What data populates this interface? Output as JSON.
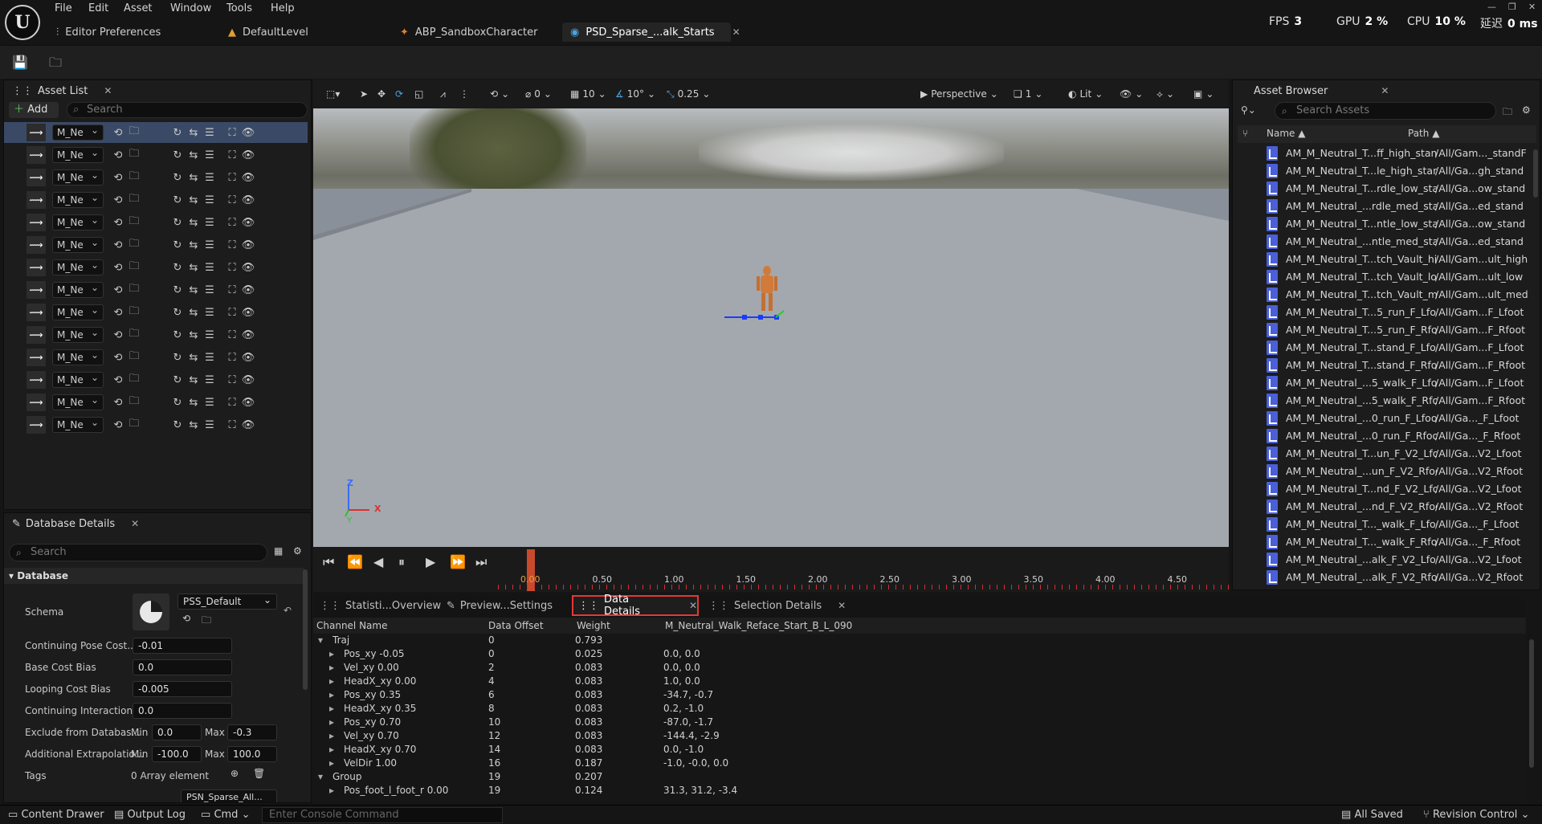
{
  "menubar": {
    "items": [
      "File",
      "Edit",
      "Asset",
      "Window",
      "Tools",
      "Help"
    ]
  },
  "doc_tabs": [
    {
      "label": "Editor Preferences"
    },
    {
      "label": "DefaultLevel"
    },
    {
      "label": "ABP_SandboxCharacter"
    },
    {
      "label": "PSD_Sparse_...alk_Starts"
    }
  ],
  "stats": {
    "fps_label": "FPS",
    "fps": "3",
    "gpu_label": "GPU",
    "gpu": "2 %",
    "cpu_label": "CPU",
    "cpu": "10 %",
    "latency_label": "延迟",
    "latency": "0 ms"
  },
  "asset_list": {
    "title": "Asset List",
    "add_label": "Add",
    "search_placeholder": "Search",
    "row_label": "M_Ne",
    "row_count": 14
  },
  "viewport": {
    "snap_rotate": "0",
    "snap_grid": "10",
    "snap_angle": "10°",
    "snap_scale": "0.25",
    "view_mode": "Perspective",
    "view_count": "1",
    "lit_label": "Lit",
    "axis_x": "X",
    "axis_z": "Z",
    "axis_y": "Y"
  },
  "timeline": {
    "ticks": [
      "0.00",
      "0.50",
      "1.00",
      "1.50",
      "2.00",
      "2.50",
      "3.00",
      "3.50",
      "4.00",
      "4.50"
    ]
  },
  "bottom_tabs": [
    {
      "label": "Statisti...Overview"
    },
    {
      "label": "Preview...Settings"
    },
    {
      "label": "Data Details"
    },
    {
      "label": "Selection Details"
    }
  ],
  "data_details": {
    "columns": [
      "Channel Name",
      "Data Offset",
      "Weight",
      "M_Neutral_Walk_Reface_Start_B_L_090"
    ],
    "rows": [
      {
        "name": "Traj",
        "offset": "0",
        "weight": "0.793",
        "value": "",
        "group": true
      },
      {
        "name": "Pos_xy -0.05",
        "offset": "0",
        "weight": "0.025",
        "value": "0.0, 0.0"
      },
      {
        "name": "Vel_xy 0.00",
        "offset": "2",
        "weight": "0.083",
        "value": "0.0, 0.0"
      },
      {
        "name": "HeadX_xy 0.00",
        "offset": "4",
        "weight": "0.083",
        "value": "1.0, 0.0"
      },
      {
        "name": "Pos_xy 0.35",
        "offset": "6",
        "weight": "0.083",
        "value": "-34.7, -0.7"
      },
      {
        "name": "HeadX_xy 0.35",
        "offset": "8",
        "weight": "0.083",
        "value": "0.2, -1.0"
      },
      {
        "name": "Pos_xy 0.70",
        "offset": "10",
        "weight": "0.083",
        "value": "-87.0, -1.7"
      },
      {
        "name": "Vel_xy 0.70",
        "offset": "12",
        "weight": "0.083",
        "value": "-144.4, -2.9"
      },
      {
        "name": "HeadX_xy 0.70",
        "offset": "14",
        "weight": "0.083",
        "value": "0.0, -1.0"
      },
      {
        "name": "VelDir 1.00",
        "offset": "16",
        "weight": "0.187",
        "value": "-1.0, -0.0, 0.0"
      },
      {
        "name": "Group",
        "offset": "19",
        "weight": "0.207",
        "value": "",
        "group": true
      },
      {
        "name": "Pos_foot_l_foot_r 0.00",
        "offset": "19",
        "weight": "0.124",
        "value": "31.3, 31.2, -3.4"
      }
    ]
  },
  "database_details": {
    "title": "Database Details",
    "search_placeholder": "Search",
    "section": "Database",
    "schema_label": "Schema",
    "schema_value": "PSS_Default",
    "continuing_pose_label": "Continuing Pose Cost...",
    "continuing_pose_value": "-0.01",
    "base_cost_label": "Base Cost Bias",
    "base_cost_value": "0.0",
    "looping_cost_label": "Looping Cost Bias",
    "looping_cost_value": "-0.005",
    "continuing_interaction_label": "Continuing Interaction...",
    "continuing_interaction_value": "0.0",
    "exclude_label": "Exclude from Databas...",
    "min_label": "Min",
    "max_label": "Max",
    "exclude_min": "0.0",
    "exclude_max": "-0.3",
    "extrapolation_label": "Additional Extrapolatio...",
    "extrap_min": "-100.0",
    "extrap_max": "100.0",
    "tags_label": "Tags",
    "tags_value": "0 Array element",
    "next_dropdown": "PSN_Sparse_All..."
  },
  "asset_browser": {
    "title": "Asset Browser",
    "search_placeholder": "Search Assets",
    "col_name": "Name",
    "col_path": "Path",
    "items": [
      {
        "name": "AM_M_Neutral_T...ff_high_standF",
        "path": "/All/Gam..._standF"
      },
      {
        "name": "AM_M_Neutral_T...le_high_stand",
        "path": "/All/Ga...gh_stand"
      },
      {
        "name": "AM_M_Neutral_T...rdle_low_stand",
        "path": "/All/Ga...ow_stand"
      },
      {
        "name": "AM_M_Neutral_...rdle_med_stand",
        "path": "/All/Ga...ed_stand"
      },
      {
        "name": "AM_M_Neutral_T...ntle_low_stand",
        "path": "/All/Ga...ow_stand"
      },
      {
        "name": "AM_M_Neutral_...ntle_med_stand",
        "path": "/All/Ga...ed_stand"
      },
      {
        "name": "AM_M_Neutral_T...tch_Vault_high",
        "path": "/All/Gam...ult_high"
      },
      {
        "name": "AM_M_Neutral_T...tch_Vault_low",
        "path": "/All/Gam...ult_low"
      },
      {
        "name": "AM_M_Neutral_T...tch_Vault_med",
        "path": "/All/Gam...ult_med"
      },
      {
        "name": "AM_M_Neutral_T...5_run_F_Lfoot",
        "path": "/All/Gam...F_Lfoot"
      },
      {
        "name": "AM_M_Neutral_T...5_run_F_Rfoot",
        "path": "/All/Gam...F_Rfoot"
      },
      {
        "name": "AM_M_Neutral_T...stand_F_Lfoot",
        "path": "/All/Gam...F_Lfoot"
      },
      {
        "name": "AM_M_Neutral_T...stand_F_Rfoot",
        "path": "/All/Gam...F_Rfoot"
      },
      {
        "name": "AM_M_Neutral_...5_walk_F_Lfoot",
        "path": "/All/Gam...F_Lfoot"
      },
      {
        "name": "AM_M_Neutral_...5_walk_F_Rfoot",
        "path": "/All/Gam...F_Rfoot"
      },
      {
        "name": "AM_M_Neutral_...0_run_F_Lfoot",
        "path": "/All/Ga..._F_Lfoot"
      },
      {
        "name": "AM_M_Neutral_...0_run_F_Rfoot",
        "path": "/All/Ga..._F_Rfoot"
      },
      {
        "name": "AM_M_Neutral_T...un_F_V2_Lfoot",
        "path": "/All/Ga...V2_Lfoot"
      },
      {
        "name": "AM_M_Neutral_...un_F_V2_Rfoot",
        "path": "/All/Ga...V2_Rfoot"
      },
      {
        "name": "AM_M_Neutral_T...nd_F_V2_Lfoot",
        "path": "/All/Ga...V2_Lfoot"
      },
      {
        "name": "AM_M_Neutral_...nd_F_V2_Rfoot",
        "path": "/All/Ga...V2_Rfoot"
      },
      {
        "name": "AM_M_Neutral_T..._walk_F_Lfoot",
        "path": "/All/Ga..._F_Lfoot"
      },
      {
        "name": "AM_M_Neutral_T..._walk_F_Rfoot",
        "path": "/All/Ga..._F_Rfoot"
      },
      {
        "name": "AM_M_Neutral_...alk_F_V2_Lfoot",
        "path": "/All/Ga...V2_Lfoot"
      },
      {
        "name": "AM_M_Neutral_...alk_F_V2_Rfoot",
        "path": "/All/Ga...V2_Rfoot"
      }
    ]
  },
  "statusbar": {
    "content_drawer": "Content Drawer",
    "output_log": "Output Log",
    "cmd": "Cmd",
    "console_placeholder": "Enter Console Command",
    "all_saved": "All Saved",
    "revision_control": "Revision Control"
  },
  "colors": {
    "highlight": "#e53935",
    "selection": "#3a4a66",
    "asset_icon": "#4a5fd8",
    "character": "#d27a3a"
  }
}
